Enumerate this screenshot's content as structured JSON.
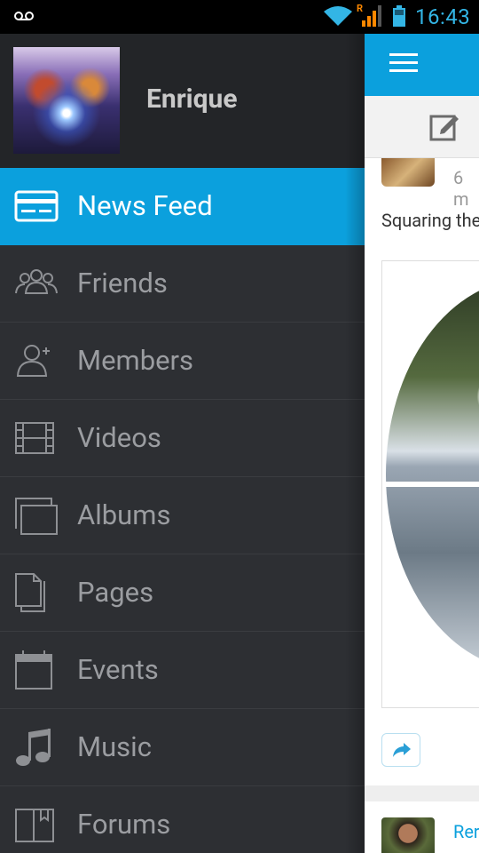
{
  "status_bar": {
    "time": "16:43",
    "roaming_indicator": "R",
    "icons": [
      "voicemail-icon",
      "wifi-icon",
      "signal-icon",
      "battery-icon"
    ]
  },
  "drawer": {
    "profile": {
      "name": "Enrique"
    },
    "items": [
      {
        "label": "News Feed",
        "icon": "news-feed-card-icon",
        "active": true
      },
      {
        "label": "Friends",
        "icon": "friends-icon"
      },
      {
        "label": "Members",
        "icon": "members-icon"
      },
      {
        "label": "Videos",
        "icon": "film-strip-icon"
      },
      {
        "label": "Albums",
        "icon": "albums-icon"
      },
      {
        "label": "Pages",
        "icon": "pages-icon"
      },
      {
        "label": "Events",
        "icon": "calendar-icon"
      },
      {
        "label": "Music",
        "icon": "music-note-icon"
      },
      {
        "label": "Forums",
        "icon": "book-icon"
      }
    ]
  },
  "feed": {
    "post1": {
      "time_ago": "6 m",
      "text": "Squaring the"
    },
    "post2": {
      "author": "Rer"
    }
  },
  "colors": {
    "accent": "#0ba0dd",
    "drawer_bg": "#2d2f33",
    "status_blue": "#33b5e5"
  }
}
